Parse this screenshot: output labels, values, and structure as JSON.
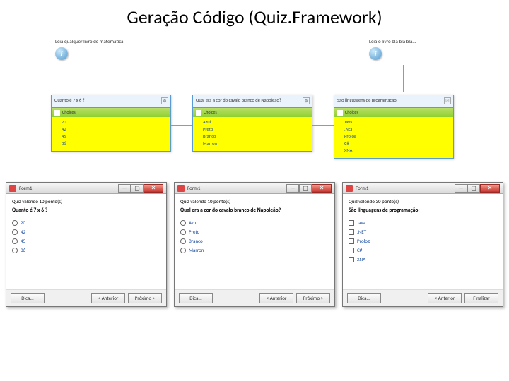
{
  "title": "Geração Código (Quiz.Framework)",
  "infoBlocks": [
    {
      "text": "Leia qualquer livro de matemática"
    },
    {
      "text": "Leia o livro bla bla bla..."
    }
  ],
  "modelCards": [
    {
      "question": "Quanto é 7 x 6 ?",
      "cornerGlyph": "⊕",
      "choicesLabel": "Choices",
      "choices": [
        "20",
        "42",
        "45",
        "36"
      ]
    },
    {
      "question": "Qual era a cor do cavalo branco de Napoleão?",
      "cornerGlyph": "⊕",
      "choicesLabel": "Choices",
      "choices": [
        "Azul",
        "Preto",
        "Branco",
        "Marron"
      ]
    },
    {
      "question": "São linguagens de programação",
      "cornerGlyph": "☑",
      "choicesLabel": "Choices",
      "choices": [
        "Java",
        ".NET",
        "Prolog",
        "C#",
        "XNA"
      ]
    }
  ],
  "forms": [
    {
      "title": "Form1",
      "caption": "Quiz valendo 10 ponto(s)",
      "question": "Quanto é 7 x 6 ?",
      "optionType": "radio",
      "options": [
        "20",
        "42",
        "45",
        "36"
      ],
      "buttons": {
        "tip": "Dica...",
        "prev": "< Anterior",
        "next": "Próximo >"
      }
    },
    {
      "title": "Form1",
      "caption": "Quiz valendo 10 ponto(s)",
      "question": "Qual era a cor do cavalo branco de Napoleão?",
      "optionType": "radio",
      "options": [
        "Azul",
        "Preto",
        "Branco",
        "Marron"
      ],
      "buttons": {
        "tip": "Dica...",
        "prev": "< Anterior",
        "next": "Próximo >"
      }
    },
    {
      "title": "Form1",
      "caption": "Quiz valendo 30 ponto(s)",
      "question": "São linguagens de programação:",
      "optionType": "checkbox",
      "options": [
        "Java",
        ".NET",
        "Prolog",
        "C#",
        "XNA"
      ],
      "buttons": {
        "tip": "Dica...",
        "prev": "< Anterior",
        "next": "Finalizar"
      }
    }
  ]
}
